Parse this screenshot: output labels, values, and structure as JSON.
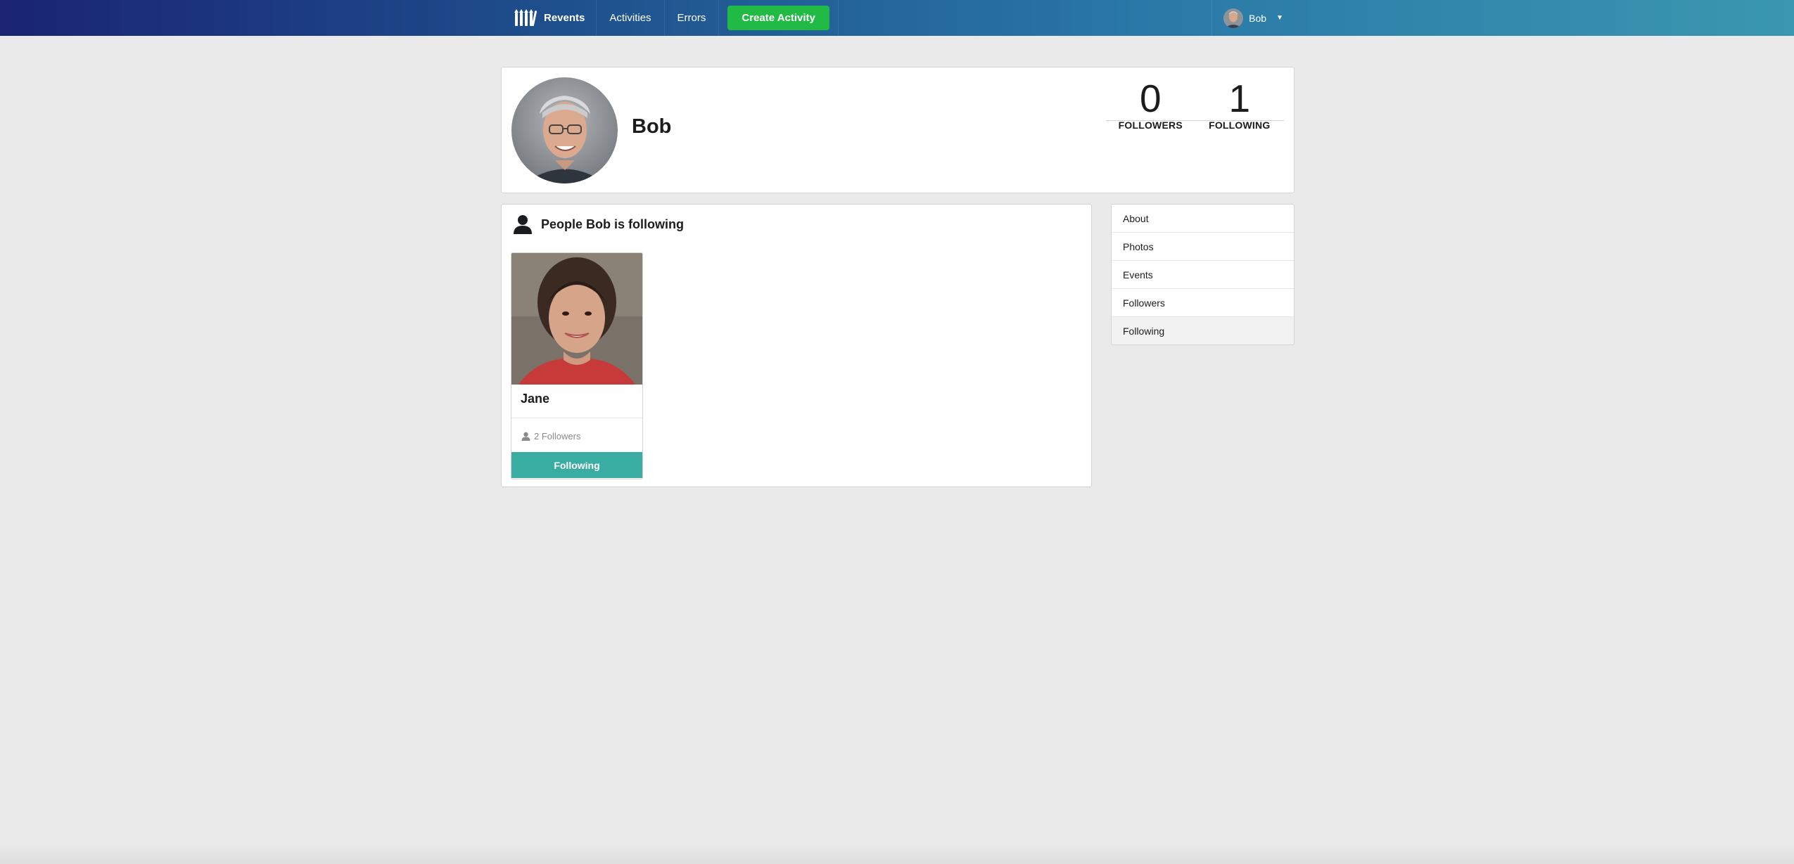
{
  "nav": {
    "brand": "Revents",
    "items": [
      {
        "label": "Activities"
      },
      {
        "label": "Errors"
      }
    ],
    "create_label": "Create Activity",
    "user_name": "Bob",
    "colors": {
      "bar_start": "#1a2472",
      "bar_end": "#3a97b0",
      "create": "#21ba45"
    }
  },
  "profile": {
    "name": "Bob",
    "stats": [
      {
        "value": "0",
        "label": "FOLLOWERS"
      },
      {
        "value": "1",
        "label": "FOLLOWING"
      }
    ]
  },
  "following_panel": {
    "title": "People Bob is following",
    "icon": "user-icon",
    "people": [
      {
        "name": "Jane",
        "followers": "2 Followers",
        "button_label": "Following",
        "button_color": "#3aada3"
      }
    ]
  },
  "side_menu": {
    "items": [
      {
        "label": "About"
      },
      {
        "label": "Photos"
      },
      {
        "label": "Events"
      },
      {
        "label": "Followers"
      },
      {
        "label": "Following"
      }
    ],
    "active": "Following"
  }
}
